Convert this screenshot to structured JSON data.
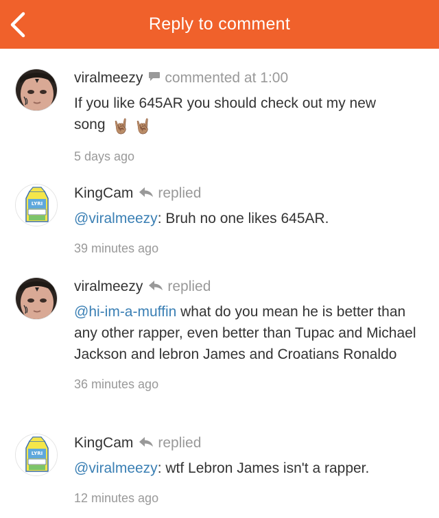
{
  "header": {
    "title": "Reply to comment"
  },
  "colors": {
    "accent": "#F0612B",
    "mention": "#3A7FB4",
    "muted": "#999999"
  },
  "comments": [
    {
      "username": "viralmeezy",
      "action_icon": "speech-bubble-icon",
      "action": "commented at 1:00",
      "mention": "",
      "text": "If you like 645AR you should check out my new song",
      "emoji": "🤘🏽 🤘🏽",
      "time": "5 days ago"
    },
    {
      "username": "KingCam",
      "action_icon": "reply-arrow-icon",
      "action": "replied",
      "mention": "@viralmeezy",
      "text": ": Bruh no one likes 645AR.",
      "time": "39 minutes ago"
    },
    {
      "username": "viralmeezy",
      "action_icon": "reply-arrow-icon",
      "action": "replied",
      "mention": "@hi-im-a-muffin",
      "text": " what do you mean he is better than any other rapper, even better than Tupac and Michael Jackson and lebron James and Croatians Ronaldo",
      "time": "36 minutes ago"
    },
    {
      "username": "KingCam",
      "action_icon": "reply-arrow-icon",
      "action": "replied",
      "mention": "@viralmeezy",
      "text": ": wtf Lebron James isn't a rapper.",
      "time": "12 minutes ago"
    }
  ]
}
